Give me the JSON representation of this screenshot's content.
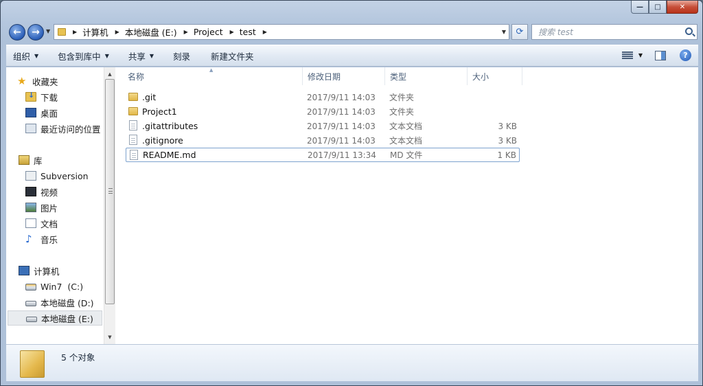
{
  "window": {
    "minimize_glyph": "—",
    "maximize_glyph": "□",
    "close_glyph": "✕"
  },
  "nav": {
    "back_glyph": "←",
    "forward_glyph": "→",
    "refresh_glyph": "⟳"
  },
  "address": {
    "crumbs": [
      "计算机",
      "本地磁盘 (E:)",
      "Project",
      "test"
    ]
  },
  "search": {
    "placeholder": "搜索 test"
  },
  "toolbar": {
    "organize": "组织",
    "include_in_library": "包含到库中",
    "share": "共享",
    "burn": "刻录",
    "new_folder": "新建文件夹"
  },
  "sidebar": {
    "favorites": "收藏夹",
    "downloads": "下载",
    "desktop": "桌面",
    "recent": "最近访问的位置",
    "libraries": "库",
    "subversion": "Subversion",
    "videos": "视频",
    "pictures": "图片",
    "documents": "文档",
    "music": "音乐",
    "computer": "计算机",
    "drive_c": "Win7  (C:)",
    "drive_d": "本地磁盘 (D:)",
    "drive_e": "本地磁盘 (E:)"
  },
  "columns": {
    "name": "名称",
    "date": "修改日期",
    "type": "类型",
    "size": "大小"
  },
  "files": [
    {
      "name": ".git",
      "date": "2017/9/11 14:03",
      "type": "文件夹",
      "size": ""
    },
    {
      "name": "Project1",
      "date": "2017/9/11 14:03",
      "type": "文件夹",
      "size": ""
    },
    {
      "name": ".gitattributes",
      "date": "2017/9/11 14:03",
      "type": "文本文档",
      "size": "3 KB"
    },
    {
      "name": ".gitignore",
      "date": "2017/9/11 14:03",
      "type": "文本文档",
      "size": "3 KB"
    },
    {
      "name": "README.md",
      "date": "2017/9/11 13:34",
      "type": "MD 文件",
      "size": "1 KB"
    }
  ],
  "details": {
    "object_count": "5 个对象"
  }
}
